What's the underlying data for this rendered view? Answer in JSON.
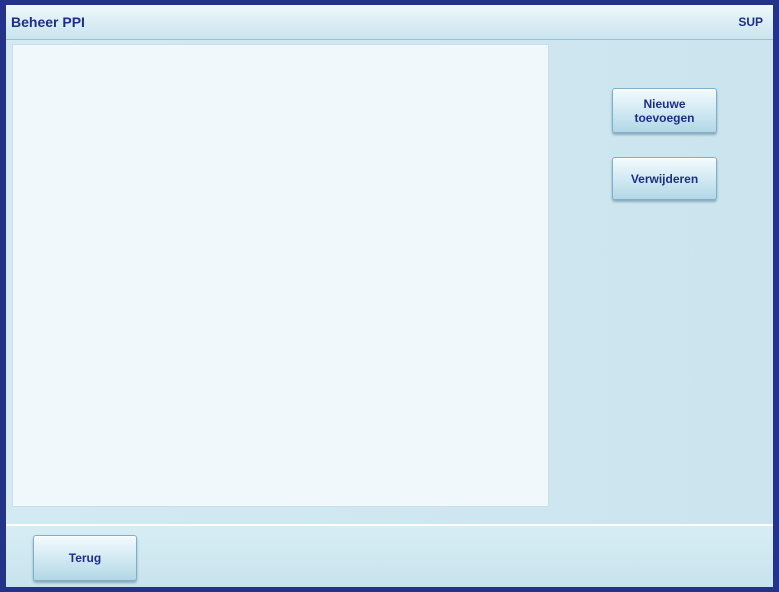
{
  "header": {
    "title": "Beheer PPI",
    "badge": "SUP"
  },
  "actions": {
    "add_label": "Nieuwe\ntoevoegen",
    "delete_label": "Verwijderen"
  },
  "footer": {
    "back_label": "Terug"
  },
  "colors": {
    "frame": "#23338a",
    "text": "#1d2f86",
    "panel": "#f1f8fb",
    "background": "#cfe6ef"
  }
}
